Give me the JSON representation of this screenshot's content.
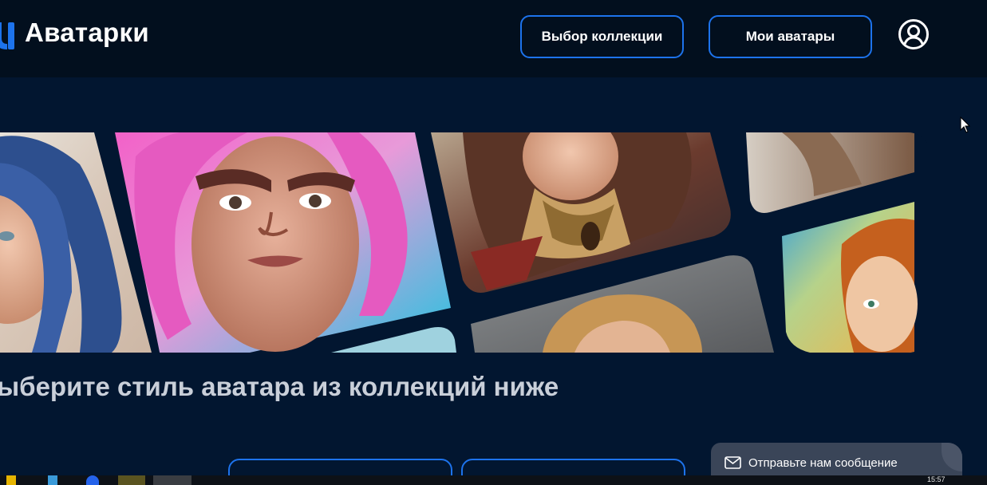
{
  "header": {
    "logo_text": "Аватарки",
    "collections_button": "Выбор коллекции",
    "my_avatars_button": "Мои аватары",
    "accent_color": "#1d73ec"
  },
  "icons": {
    "logo": "logo-mark-icon",
    "profile": "user-circle-icon",
    "cursor": "cursor-icon",
    "chat": "mail-icon"
  },
  "main": {
    "headline": "ыберите стиль аватара из коллекций ниже"
  },
  "chat": {
    "label": "Отправьте нам сообщение"
  },
  "taskbar": {
    "clock": "15:57"
  }
}
